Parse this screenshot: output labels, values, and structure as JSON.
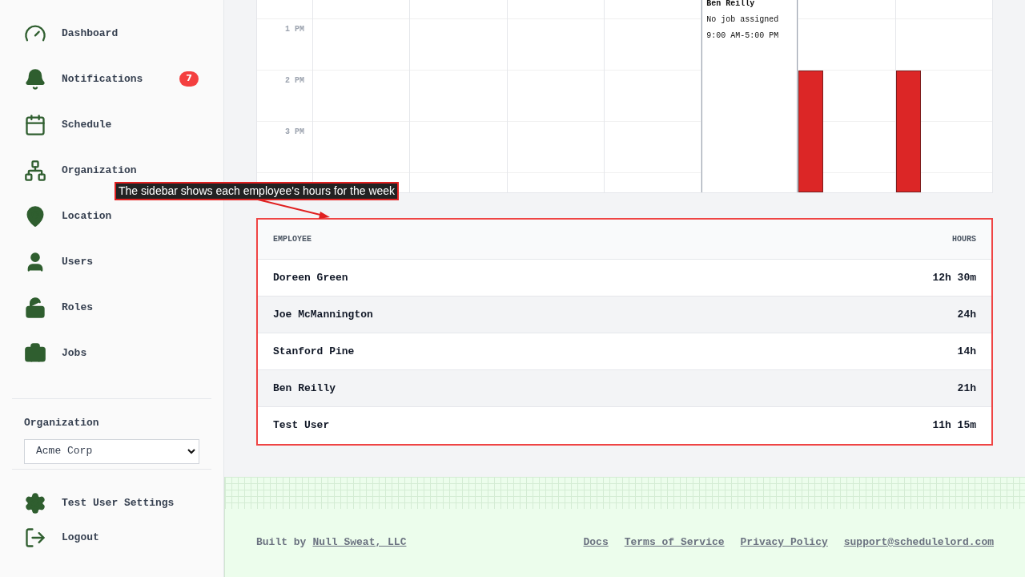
{
  "sidebar": {
    "items": [
      {
        "kind": "dashboard",
        "label": "Dashboard"
      },
      {
        "kind": "notifications",
        "label": "Notifications",
        "badge": "7"
      },
      {
        "kind": "schedule",
        "label": "Schedule"
      },
      {
        "kind": "organization",
        "label": "Organization"
      },
      {
        "kind": "location",
        "label": "Location"
      },
      {
        "kind": "users",
        "label": "Users"
      },
      {
        "kind": "roles",
        "label": "Roles"
      },
      {
        "kind": "jobs",
        "label": "Jobs"
      }
    ],
    "organization_label": "Organization",
    "organization_select": {
      "value": "Acme Corp"
    },
    "bottom_items": [
      {
        "kind": "settings",
        "label": "Test User Settings"
      },
      {
        "kind": "logout",
        "label": "Logout"
      }
    ]
  },
  "calendar": {
    "hours": [
      "1 PM",
      "2 PM",
      "3 PM"
    ],
    "days": [
      {
        "kind": "empty"
      },
      {
        "kind": "empty"
      },
      {
        "kind": "empty"
      },
      {
        "kind": "empty"
      },
      {
        "kind": "card",
        "name": "Ben Reilly",
        "job": "No job assigned",
        "time": "9:00 AM-5:00 PM"
      },
      {
        "kind": "bar",
        "color": "#dc2626"
      },
      {
        "kind": "bar",
        "color": "#dc2626"
      }
    ]
  },
  "annotation": {
    "text": "The sidebar shows each employee's hours for the week"
  },
  "hours_table": {
    "columns": [
      "EMPLOYEE",
      "HOURS"
    ],
    "rows": [
      {
        "employee": "Doreen Green",
        "hours": "12h 30m"
      },
      {
        "employee": "Joe McMannington",
        "hours": "24h"
      },
      {
        "employee": "Stanford Pine",
        "hours": "14h"
      },
      {
        "employee": "Ben Reilly",
        "hours": "21h"
      },
      {
        "employee": "Test User",
        "hours": "11h 15m"
      }
    ]
  },
  "footer": {
    "built_by": "Built by",
    "built_by_link": "Null Sweat, LLC",
    "links": [
      "Docs",
      "Terms of Service",
      "Privacy Policy",
      "support@schedulelord.com"
    ]
  }
}
